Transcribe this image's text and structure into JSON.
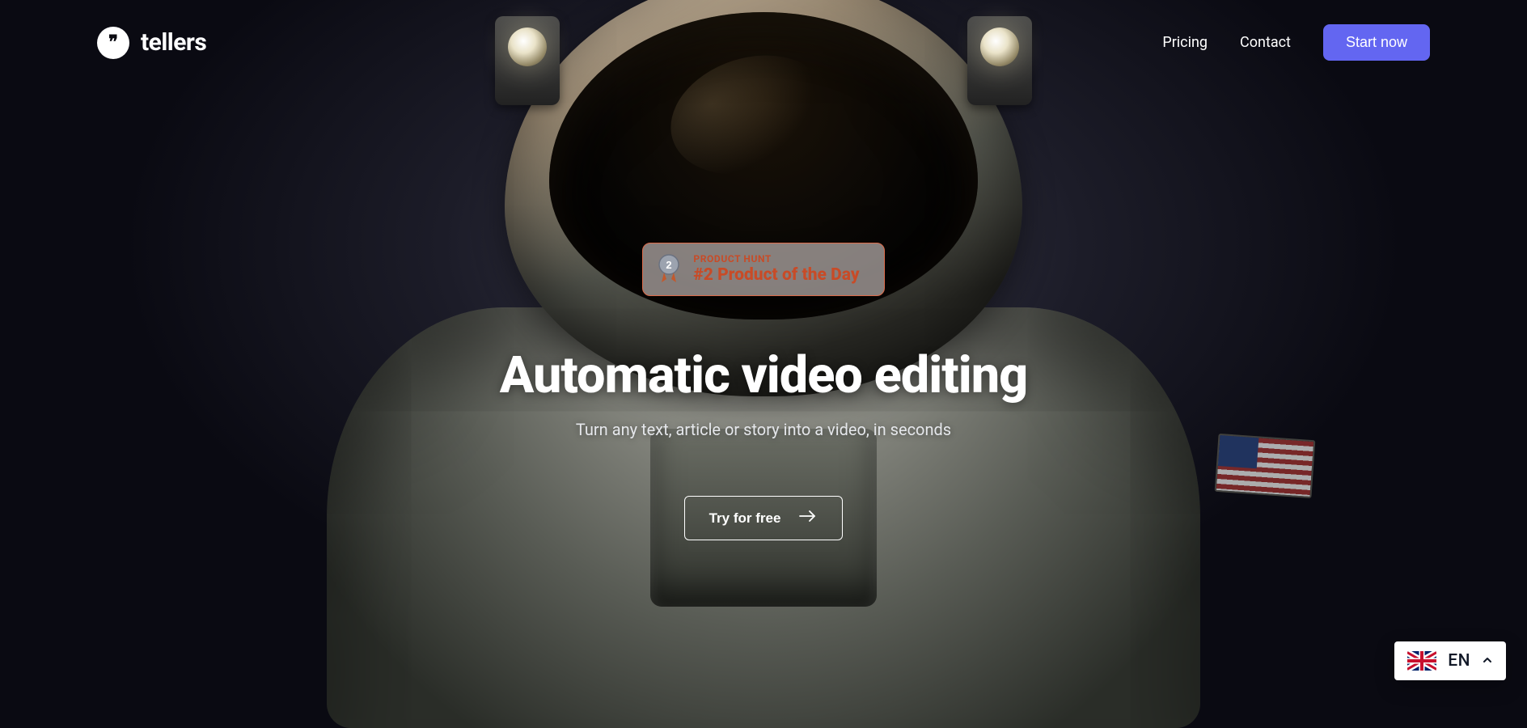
{
  "brand": {
    "name": "tellers",
    "mark_glyph": "❞"
  },
  "nav": {
    "pricing": "Pricing",
    "contact": "Contact",
    "cta": "Start now"
  },
  "product_hunt": {
    "label": "PRODUCT HUNT",
    "title": "#2 Product of the Day",
    "rank": "2"
  },
  "hero": {
    "headline": "Automatic video editing",
    "subhead": "Turn any text, article or story into a video, in seconds",
    "cta": "Try for free"
  },
  "language": {
    "code": "EN"
  },
  "colors": {
    "primary": "#6366f1",
    "ph_accent": "#c84b27"
  }
}
